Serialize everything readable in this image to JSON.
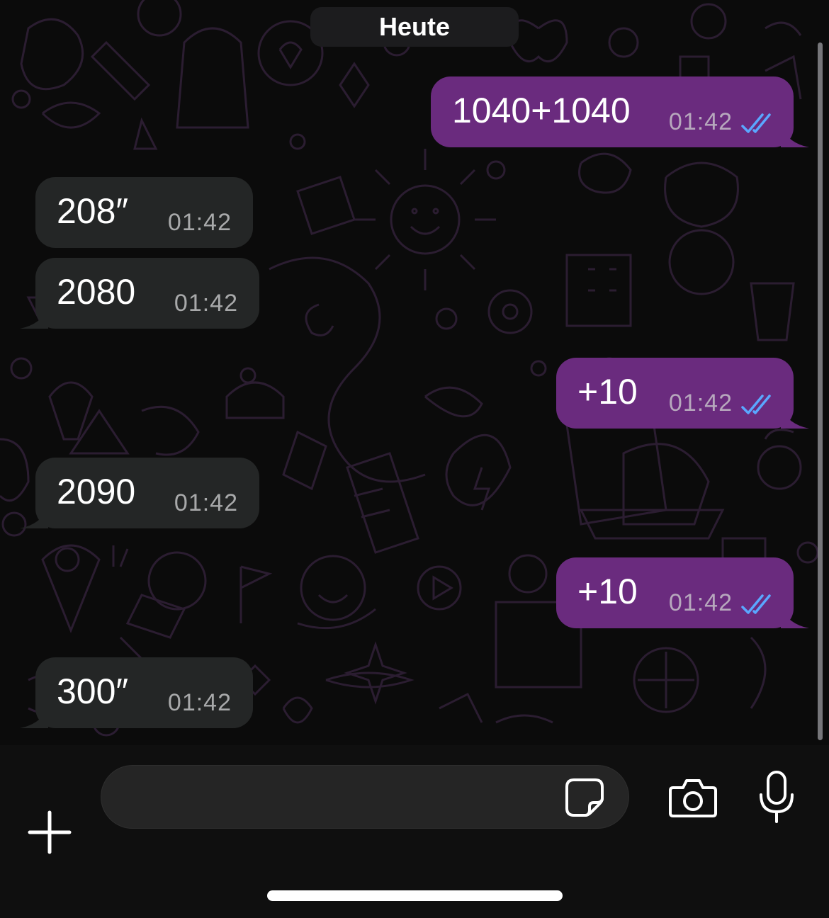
{
  "header": {
    "date_label": "Heute"
  },
  "messages": [
    {
      "direction": "out",
      "text": "1040+1040",
      "time": "01:42",
      "status": "read"
    },
    {
      "direction": "in",
      "text": "208″",
      "time": "01:42"
    },
    {
      "direction": "in",
      "text": "2080",
      "time": "01:42"
    },
    {
      "direction": "out",
      "text": "+10",
      "time": "01:42",
      "status": "read"
    },
    {
      "direction": "in",
      "text": "2090",
      "time": "01:42"
    },
    {
      "direction": "out",
      "text": "+10",
      "time": "01:42",
      "status": "read"
    },
    {
      "direction": "in",
      "text": "300″",
      "time": "01:42"
    }
  ],
  "composer": {
    "placeholder": "",
    "value": ""
  },
  "icons": {
    "attach": "plus-icon",
    "sticker": "sticker-icon",
    "camera": "camera-icon",
    "mic": "microphone-icon",
    "read_receipt": "double-check-icon"
  },
  "colors": {
    "outgoing_bubble": "#6a2b7e",
    "incoming_bubble": "#242626",
    "read_tick": "#5aa7ff",
    "background": "#0b0b0b"
  }
}
